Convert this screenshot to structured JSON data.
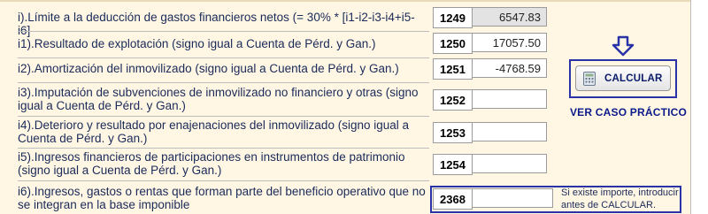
{
  "rows": [
    {
      "label": "i).Límite a la deducción de gastos financieros netos (= 30% * [i1-i2-i3-i4+i5-i6]",
      "code": "1249",
      "value": "6547.83"
    },
    {
      "label": "i1).Resultado de explotación (signo igual a Cuenta de Pérd. y Gan.)",
      "code": "1250",
      "value": "17057.50"
    },
    {
      "label": "i2).Amortización del inmovilizado (signo igual a Cuenta de Pérd. y Gan.)",
      "code": "1251",
      "value": "-4768.59"
    },
    {
      "label": "i3).Imputación de subvenciones de inmovilizado no financiero y otras (signo igual a Cuenta de Pérd. y Gan.)",
      "code": "1252",
      "value": ""
    },
    {
      "label": "i4).Deterioro y resultado por enajenaciones del inmovilizado (signo igual a Cuenta de Pérd. y Gan.)",
      "code": "1253",
      "value": ""
    },
    {
      "label": "i5).Ingresos financieros de participaciones en instrumentos de patrimonio (signo igual a Cuenta de Pérd. y Gan.)",
      "code": "1254",
      "value": ""
    },
    {
      "label": "i6).Ingresos, gastos o rentas que forman parte del beneficio operativo que no se integran en la base imponible",
      "code": "2368",
      "value": ""
    }
  ],
  "calculate_button": {
    "label": "CALCULAR"
  },
  "example_link": "VER CASO PRÁCTICO",
  "note": "Si existe importe, introducir antes de CALCULAR."
}
